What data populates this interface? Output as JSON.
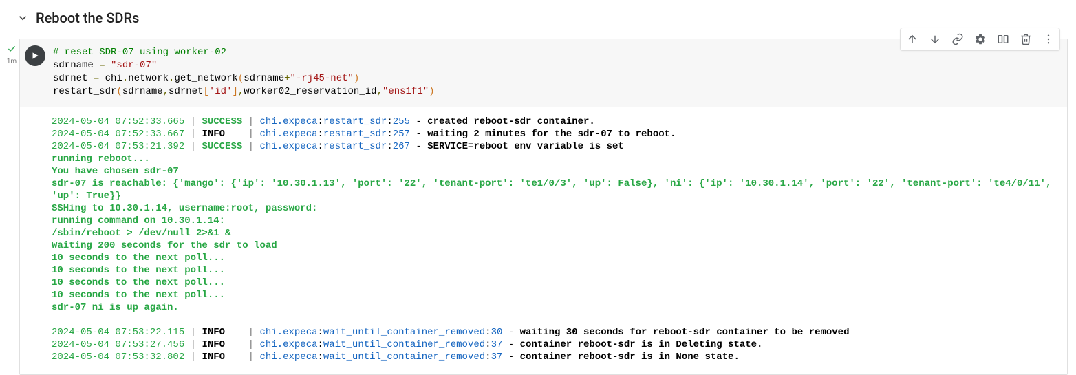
{
  "section": {
    "title": "Reboot the SDRs"
  },
  "gutter": {
    "exec_time": "1m"
  },
  "code": {
    "comment": "# reset SDR-07 using worker-02",
    "l2_a": "sdrname ",
    "l2_eq": "=",
    "l2_sp": " ",
    "l2_str": "\"sdr-07\"",
    "l3_a": "sdrnet ",
    "l3_eq": "=",
    "l3_b": " chi",
    "l3_dot1": ".",
    "l3_c": "network",
    "l3_dot2": ".",
    "l3_d": "get_network",
    "l3_lp": "(",
    "l3_e": "sdrname",
    "l3_plus": "+",
    "l3_str": "\"-rj45-net\"",
    "l3_rp": ")",
    "l4_a": "restart_sdr",
    "l4_lp": "(",
    "l4_b": "sdrname",
    "l4_c": ",",
    "l4_d": "sdrnet",
    "l4_lb": "[",
    "l4_str1": "'id'",
    "l4_rb": "]",
    "l4_e": ",",
    "l4_f": "worker02_reservation_id",
    "l4_g": ",",
    "l4_str2": "\"ens1f1\"",
    "l4_rp": ")"
  },
  "output": {
    "logs1": [
      {
        "ts": "2024-05-04 07:52:33.665",
        "level": "SUCCESS",
        "level_class": "lvl-success",
        "module": "chi.expeca",
        "func": "restart_sdr",
        "line": "255",
        "msg": "created reboot-sdr container."
      },
      {
        "ts": "2024-05-04 07:52:33.667",
        "level": "INFO   ",
        "level_class": "lvl-info",
        "module": "chi.expeca",
        "func": "restart_sdr",
        "line": "257",
        "msg": "waiting 2 minutes for the sdr-07 to reboot."
      },
      {
        "ts": "2024-05-04 07:53:21.392",
        "level": "SUCCESS",
        "level_class": "lvl-success",
        "module": "chi.expeca",
        "func": "restart_sdr",
        "line": "267",
        "msg": "SERVICE=reboot env variable is set"
      }
    ],
    "stdout": [
      "running reboot...",
      "You have chosen sdr-07",
      "sdr-07 is reachable: {'mango': {'ip': '10.30.1.13', 'port': '22', 'tenant-port': 'te1/0/3', 'up': False}, 'ni': {'ip': '10.30.1.14', 'port': '22', 'tenant-port': 'te4/0/11', 'up': True}}",
      "SSHing to 10.30.1.14, username:root, password:",
      "running command on 10.30.1.14:",
      "/sbin/reboot > /dev/null 2>&1 &",
      "Waiting 200 seconds for the sdr to load",
      "10 seconds to the next poll...",
      "10 seconds to the next poll...",
      "10 seconds to the next poll...",
      "10 seconds to the next poll...",
      "sdr-07 ni is up again."
    ],
    "logs2": [
      {
        "ts": "2024-05-04 07:53:22.115",
        "level": "INFO   ",
        "level_class": "lvl-info",
        "module": "chi.expeca",
        "func": "wait_until_container_removed",
        "line": "30",
        "msg": "waiting 30 seconds for reboot-sdr container to be removed"
      },
      {
        "ts": "2024-05-04 07:53:27.456",
        "level": "INFO   ",
        "level_class": "lvl-info",
        "module": "chi.expeca",
        "func": "wait_until_container_removed",
        "line": "37",
        "msg": "container reboot-sdr is in Deleting state."
      },
      {
        "ts": "2024-05-04 07:53:32.802",
        "level": "INFO   ",
        "level_class": "lvl-info",
        "module": "chi.expeca",
        "func": "wait_until_container_removed",
        "line": "37",
        "msg": "container reboot-sdr is in None state."
      }
    ]
  },
  "toolbar": {
    "move_up": "Move cell up",
    "move_down": "Move cell down",
    "link": "Link to cell",
    "settings": "Editor settings",
    "mirror": "Mirror cell",
    "delete": "Delete cell",
    "more": "More cell actions"
  }
}
